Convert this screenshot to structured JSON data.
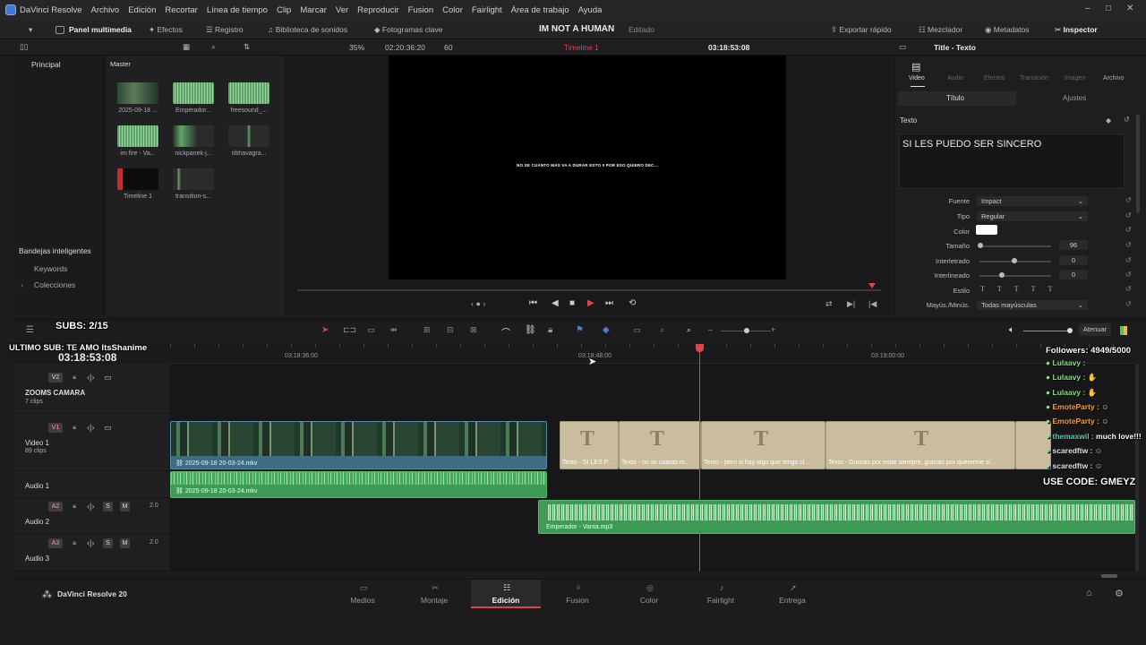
{
  "app": {
    "name": "DaVinci Resolve",
    "menus": [
      "Archivo",
      "Edición",
      "Recortar",
      "Línea de tiempo",
      "Clip",
      "Marcar",
      "Ver",
      "Reproducir",
      "Fusion",
      "Color",
      "Fairlight",
      "Área de trabajo",
      "Ayuda"
    ]
  },
  "toolbar": {
    "media_pool": "Panel multimedia",
    "effects": "Efectos",
    "log": "Registro",
    "sound_library": "Biblioteca de sonidos",
    "keyframes": "Fotogramas clave",
    "project_title": "IM NOT A HUMAN",
    "project_status": "Editado",
    "quick_export": "Exportar rápido",
    "mixer": "Mezclador",
    "metadata": "Metadatos",
    "inspector": "Inspector"
  },
  "viewer_bar": {
    "zoom": "35%",
    "source_tc": "02:20:36:20",
    "fps": "60",
    "timeline_name": "Timeline 1",
    "record_tc": "03:18:53:08"
  },
  "media": {
    "tab_main": "Principal",
    "tab_master": "Master",
    "smart_bins": "Bandejas inteligentes",
    "keywords": "Keywords",
    "collections": "Colecciones",
    "clips": [
      {
        "name": "2025-09-18 ..."
      },
      {
        "name": "Emperador..."
      },
      {
        "name": "freesound_..."
      },
      {
        "name": "im fire - Va..."
      },
      {
        "name": "nickpanek-j..."
      },
      {
        "name": "ribhavagra..."
      },
      {
        "name": "Timeline 1"
      },
      {
        "name": "transition-s..."
      }
    ]
  },
  "viewer": {
    "subtitle": "NO SE CUANTO MAS VA A DURAR ESTO 0 POR ESO QUIERO DEC..."
  },
  "inspector": {
    "header": "Title - Texto",
    "tabs": [
      "Video",
      "Audio",
      "Efectos",
      "Transición",
      "Imagen",
      "Archivo"
    ],
    "subtab_title": "Título",
    "subtab_settings": "Ajustes",
    "section": "Texto",
    "text_value": "SI LES PUEDO SER SINCERO",
    "font_label": "Fuente",
    "font_value": "Impact",
    "type_label": "Tipo",
    "type_value": "Regular",
    "color_label": "Color",
    "color_value": "#ffffff",
    "size_label": "Tamaño",
    "size_value": "96",
    "tracking_label": "Interletrado",
    "tracking_value": "0",
    "linespacing_label": "Interlineado",
    "linespacing_value": "0",
    "style_label": "Estilo",
    "case_label": "Mayús./Minús.",
    "case_value": "Todas mayúsculas"
  },
  "timeline": {
    "timecode": "03:18:53:08",
    "dim_label": "Atenuar",
    "ruler": [
      "03:18:36:00",
      "03:18:48:00",
      "03:19:00:00"
    ],
    "tracks": {
      "v2": {
        "badge": "V2",
        "name": "ZOOMS CAMARA",
        "count": "7 clips"
      },
      "v1": {
        "badge": "V1",
        "name": "Video 1",
        "count": "89 clips"
      },
      "a1": {
        "name": "Audio 1"
      },
      "a2": {
        "badge": "A2",
        "name": "Audio 2",
        "level": "2.0"
      },
      "a3": {
        "badge": "A3",
        "name": "Audio 3",
        "level": "2.0"
      }
    },
    "clips": {
      "video_main": "2025-09-18 20-03-24.mkv",
      "audio_main": "2025-09-18 20-03-24.mkv",
      "audio_music": "Emperador - Vanta.mp3",
      "titles": [
        "Texto - SI LES P...",
        "Texto - no se cuanto m...",
        "Texto - pero si hay algo que tengo cl...",
        "Texto - Gracias por estar siempre, gracias por quererme si..."
      ]
    }
  },
  "overlay": {
    "subs": "SUBS: 2/15",
    "last_sub": "ULTIMO SUB: TE AMO ItsShanime",
    "followers": "Followers: 4949/5000",
    "code": "USE CODE: GMEYZ",
    "chat": [
      {
        "user": "Lulaavy :",
        "color": "#7ee07e"
      },
      {
        "user": "Lulaavy :",
        "color": "#7ee07e"
      },
      {
        "user": "Lulaavy :",
        "color": "#7ee07e"
      },
      {
        "user": "EmoteParty :",
        "color": "#f0a030"
      },
      {
        "user": "EmoteParty :",
        "color": "#f0a030"
      },
      {
        "user": "themaxwil :",
        "color": "#4fd0b0",
        "msg": "much love!!!"
      },
      {
        "user": "scaredftw :",
        "color": "#e0e0e0"
      },
      {
        "user": "scaredftw :",
        "color": "#e0e0e0"
      }
    ]
  },
  "pages": {
    "brand": "DaVinci Resolve 20",
    "tabs": [
      "Medios",
      "Montaje",
      "Edición",
      "Fusion",
      "Color",
      "Fairlight",
      "Entrega"
    ],
    "active": "Edición"
  }
}
